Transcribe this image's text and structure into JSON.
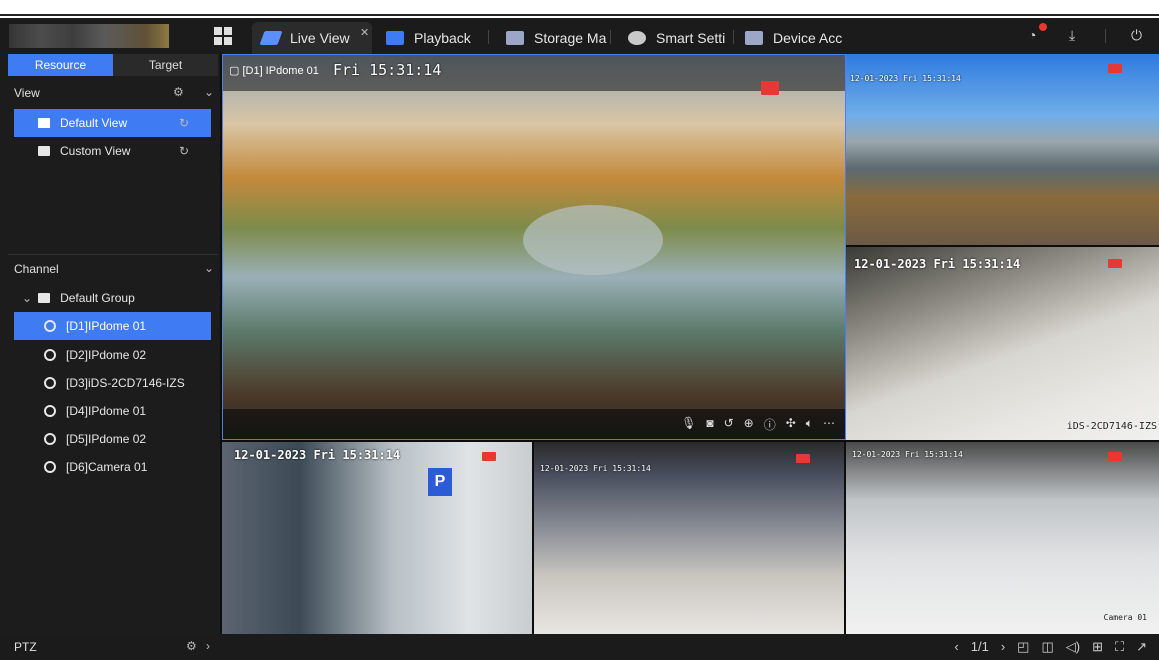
{
  "tabs": [
    {
      "label": "Live View",
      "icon": "live-view-icon",
      "color": "#5b8ff9"
    },
    {
      "label": "Playback",
      "icon": "playback-icon",
      "color": "#3f7bf2"
    },
    {
      "label": "Storage Ma",
      "icon": "storage-icon",
      "color": "#9aa7c7"
    },
    {
      "label": "Smart Setti",
      "icon": "smart-settings-icon",
      "color": "#c9c9c9"
    },
    {
      "label": "Device Acc",
      "icon": "device-access-icon",
      "color": "#9aa7c7"
    }
  ],
  "sidebar": {
    "tabs": {
      "resource": "Resource",
      "target": "Target"
    },
    "view": {
      "heading": "View",
      "items": [
        {
          "label": "Default View"
        },
        {
          "label": "Custom View"
        }
      ]
    },
    "channel": {
      "heading": "Channel",
      "group": "Default Group",
      "items": [
        {
          "label": "[D1]IPdome 01"
        },
        {
          "label": "[D2]IPdome 02"
        },
        {
          "label": "[D3]iDS-2CD7146-IZS"
        },
        {
          "label": "[D4]IPdome 01"
        },
        {
          "label": "[D5]IPdome 02"
        },
        {
          "label": "[D6]Camera 01"
        }
      ]
    }
  },
  "main_tile": {
    "label": "[D1] IPdome 01",
    "timestamp": "Fri  15:31:14"
  },
  "tiles": [
    {
      "osd": "12-01-2023 Fri 15:31:14"
    },
    {
      "osd": "12-01-2023 Fri 15:31:14",
      "name": "iDS-2CD7146-IZS"
    },
    {
      "osd": "12-01-2023 Fri 15:31:14"
    },
    {
      "osd": "12-01-2023 Fri 15:31:14"
    },
    {
      "osd": "12-01-2023 Fri 15:31:14",
      "name": "Camera 01"
    }
  ],
  "bottom": {
    "ptz": "PTZ",
    "page": "1/1"
  },
  "colors": {
    "accent": "#3f7bf2",
    "record": "#e53935"
  }
}
